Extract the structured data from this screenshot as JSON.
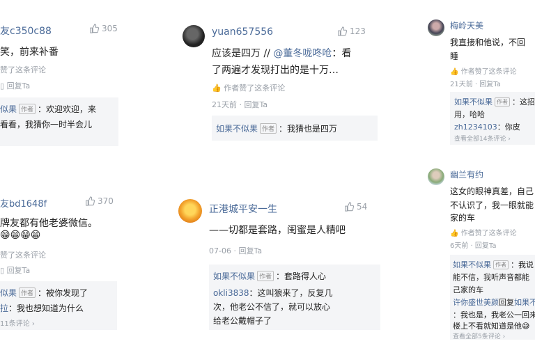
{
  "c1": {
    "username": "友c350c88",
    "likes": "305",
    "text": "笑，前来补番",
    "liked_by_author": "赞了这条评论",
    "reply_label": "回复Ta",
    "replies": [
      {
        "name": "似果",
        "tag": "作者",
        "text": "：欢迎欢迎，来"
      },
      {
        "text": "看看，我猜你一时半会儿"
      }
    ]
  },
  "c2": {
    "username": "yuan657556",
    "likes": "123",
    "text1": "应该是四万 // ",
    "mention": "@董冬咙咚呛",
    "text1b": "：看",
    "text2": "了两遍才发现打出的是十万…",
    "liked_by_author": "作者赞了这条评论",
    "time": "21天前",
    "reply_label": "回复Ta",
    "reply": {
      "name": "如果不似果",
      "tag": "作者",
      "text": "：我猜也是四万"
    }
  },
  "c3": {
    "username": "梅岭天美",
    "text1": "我直接和他说，不回",
    "text2": "睡",
    "liked_by_author": "作者赞了这条评论",
    "time": "21天前",
    "reply_label": "回复Ta",
    "reply1": {
      "name": "如果不似果",
      "tag": "作者",
      "text": "：这招"
    },
    "reply1b": "用，哈哈",
    "reply2": {
      "name": "zh1234103",
      "text": "：你皮"
    },
    "more": "查看全部14条评论 ›"
  },
  "c4": {
    "username": "友bd1648f",
    "likes": "370",
    "text": "牌友都有他老婆微信。",
    "emoji": "😁😁😁😁",
    "liked_by_author": "赞了这条评论",
    "reply_label": "回复Ta",
    "reply1": {
      "name": "似果",
      "tag": "作者",
      "text": "：被你发现了"
    },
    "reply2": {
      "name": "拉",
      "text": "：我也想知道为什么"
    },
    "more": "11条评论 ›"
  },
  "c5": {
    "username": "正港城平安一生",
    "likes": "54",
    "text": "——切都是套路，闺蜜是人精吧",
    "time": "07-06",
    "reply_label": "回复Ta",
    "reply1": {
      "name": "如果不似果",
      "tag": "作者",
      "text": "：套路得人心"
    },
    "reply2": {
      "name": "okli3838",
      "text": "：这叫狼来了，反复几"
    },
    "reply2b": "次，他老公不信了，就可以放心",
    "reply2c": "给老公戴帽子了"
  },
  "c6": {
    "username": "幽兰有约",
    "text1": "这女的眼神真差，自己",
    "text2": "不认识了，我一眼就能",
    "text3": "家的车",
    "liked_by_author": "作者赞了这条评论",
    "time": "6天前",
    "reply_label": "回复Ta",
    "reply1": {
      "name": "如果不似果",
      "tag": "作者",
      "text": "：我说"
    },
    "reply1b": "能不信，我听声音都能",
    "reply1c": "己家的车",
    "reply2": {
      "name": "许你盛世美颜",
      "text": "回复",
      "target": "如果不"
    },
    "reply2b": "：我也是，我老公一回来",
    "reply2c": "楼上不看就知道是他😅",
    "more": "查看全部5条评论 ›"
  }
}
